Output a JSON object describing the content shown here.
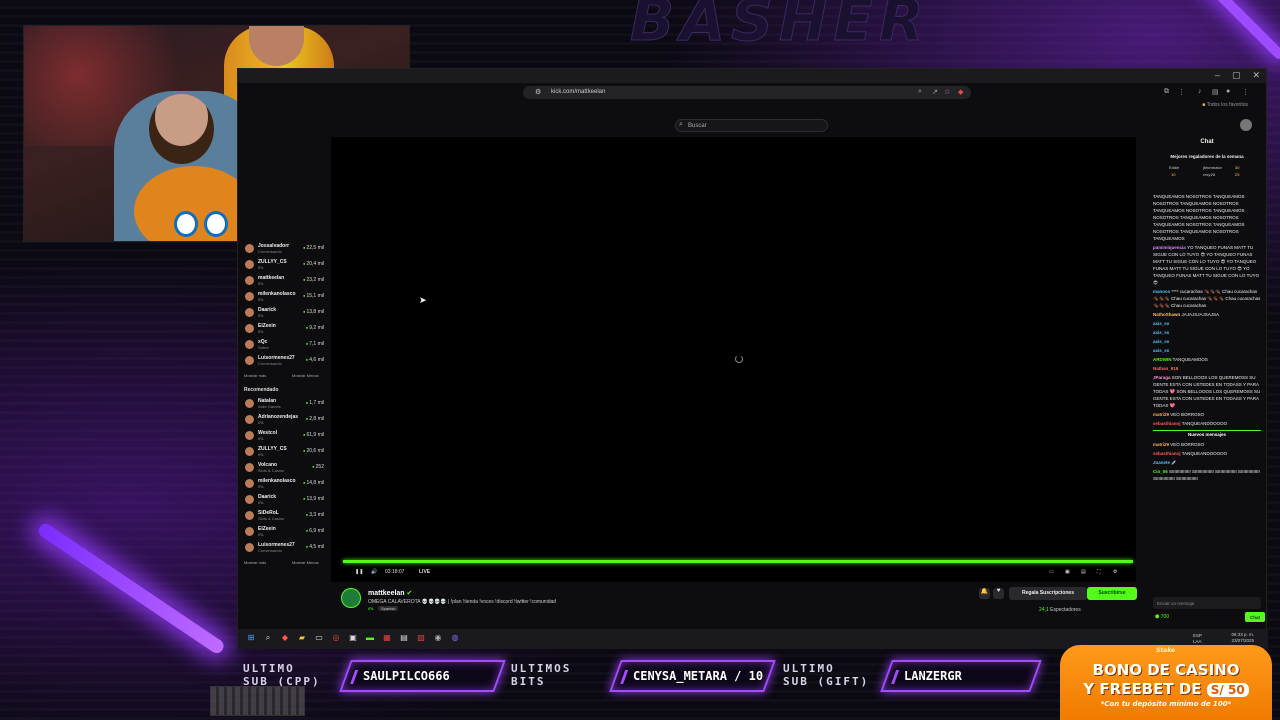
{
  "overlay": {
    "brand_text": "BASHER",
    "labels": [
      "ULTIMO\nSUB (CPP)",
      "ULTIMOS\nBITS",
      "ULTIMO\nSUB (GIFT)"
    ],
    "last_sub_cpp": "SAULPILCO666",
    "last_bits": "CENYSA_METARA / 10",
    "last_sub_gift": "LANZERGR",
    "promo": {
      "logo": "Stake",
      "line1": "BONO DE CASINO",
      "line2": "Y FREEBET DE",
      "amount": "S/ 50",
      "line3": "*Con tu depósito mínimo de 100*"
    }
  },
  "browser": {
    "url": "kick.com/mattkeelan",
    "favorites": "Todos los favoritos",
    "search_placeholder": "Buscar",
    "window_controls": [
      "–",
      "▢",
      "✕"
    ]
  },
  "sidebar": {
    "following": [
      {
        "name": "Jossalvadorr",
        "category": "Conversando",
        "viewers": "22,5 mil"
      },
      {
        "name": "ZULLYY_CS",
        "category": "IRL",
        "viewers": "20,4 mil"
      },
      {
        "name": "mattkeelan",
        "category": "IRL",
        "viewers": "23,2 mil"
      },
      {
        "name": "milenkanolasco",
        "category": "IRL",
        "viewers": "15,1 mil"
      },
      {
        "name": "Daarick",
        "category": "IRL",
        "viewers": "13,8 mil"
      },
      {
        "name": "ElZeein",
        "category": "IRL",
        "viewers": "9,2 mil"
      },
      {
        "name": "xQc",
        "category": "Sobre",
        "viewers": "7,1 mil"
      },
      {
        "name": "Luisormenes27",
        "category": "Conversando",
        "viewers": "4,6 mil"
      }
    ],
    "show_more": "Mostrar más",
    "show_less": "Mostrar Menos",
    "recommended_title": "Recomendado",
    "recommended": [
      {
        "name": "Natalan",
        "category": "Indie Games",
        "viewers": "1,7 mil"
      },
      {
        "name": "Adrianozendejas",
        "category": "IRL",
        "viewers": "2,8 mil"
      },
      {
        "name": "Westcol",
        "category": "IRL",
        "viewers": "61,9 mil"
      },
      {
        "name": "ZULLYY_CS",
        "category": "IRL",
        "viewers": "20,6 mil"
      },
      {
        "name": "Volcano",
        "category": "Slots & Casino",
        "viewers": "252"
      },
      {
        "name": "milenkanolasco",
        "category": "IRL",
        "viewers": "14,8 mil"
      },
      {
        "name": "Daarick",
        "category": "IRL",
        "viewers": "13,9 mil"
      },
      {
        "name": "SiDeRoL",
        "category": "Slots & Casino",
        "viewers": "3,3 mil"
      },
      {
        "name": "ElZeein",
        "category": "IRL",
        "viewers": "6,9 mil"
      },
      {
        "name": "Luisormenes27",
        "category": "Conversando",
        "viewers": "4,5 mil"
      }
    ]
  },
  "player": {
    "time": "03:18:07",
    "live": "LIVE",
    "progress": 1.0
  },
  "stream": {
    "streamer": "mattkeelan",
    "title": "OMEGA CALAVEROTA 💀💀💀💀 | !plan !tienda !voces !discord !twitter !comunidad",
    "category": "IRL",
    "language": "Spanish",
    "gift_label": "Regala Suscripciones",
    "subscribe_label": "Suscribirse",
    "viewers": "24,1",
    "viewers_label": "Espectadores"
  },
  "chat": {
    "title": "Chat",
    "top_gifters_title": "Mejores regaladores de la semana",
    "gifters": [
      {
        "name": "Eddie",
        "count": "10"
      },
      {
        "name": "jbhermalor",
        "count": "30"
      },
      {
        "name": "rexy28",
        "count": "25"
      }
    ],
    "pinned": "Enviado por",
    "messages": [
      {
        "user": "",
        "text": "TANQUEAMOS NOSOTROS TANQUEAMOS NOSOTROS TANQUEAMOS NOSOTROS TANQUEAMOS NOSOTROS TANQUEAMOS NOSOTROS TANQUEAMOS NOSOTROS TANQUEAMOS NOSOTROS TANQUEAMOS NOSOTROS TANQUEAMOS NOSOTROS TANQUEAMOS",
        "color": "#e8e8ee"
      },
      {
        "user": "pamimiquencia",
        "text": "YO TANQUEO FUNAS MATT TU SIGUE CON LO TUYO 😎 YO TANQUEO FUNAS MATT TU SIGUE CON LO TUYO 😎 YO TANQUEO FUNAS MATT TU SIGUE CON LO TUYO 😎 YO TANQUEO FUNAS MATT TU SIGUE CON LO TUYO 😎",
        "color": "#d98cff"
      },
      {
        "user": "manoco",
        "text": "**** cucarachas 🪳🪳🪳 Chau cucarachas 🪳🪳🪳 Chau cucarachas 🪳🪳🪳 Chau cucarachas 🪳🪳🪳 Chau cucarachas",
        "color": "#53c6fc"
      },
      {
        "user": "NathoShawn",
        "text": "JAJAJSJAJSAJSA",
        "color": "#ffc14a"
      },
      {
        "user": "axis_ss",
        "text": "",
        "color": "#53c6fc"
      },
      {
        "user": "axis_ss",
        "text": "",
        "color": "#53c6fc"
      },
      {
        "user": "axis_ss",
        "text": "",
        "color": "#53c6fc"
      },
      {
        "user": "axis_ss",
        "text": "",
        "color": "#53c6fc"
      },
      {
        "user": "ARDWIN",
        "text": "TANQUEAMOOS",
        "color": "#53fc18"
      },
      {
        "user": "Nathan_616",
        "text": "",
        "color": "#ff6b6b"
      },
      {
        "user": "JParaga",
        "text": "SON BELLOOOS LOS QUEREMOSS SU GENTE ESTA CON USTEDES EN TODASS Y PARA TODAS 💖 SON BELLOOOS LOS QUEREMOSS SU GENTE ESTA CON USTEDES EN TODASS Y PARA TODAS 💖",
        "color": "#ff8cd9"
      },
      {
        "user": "matri29",
        "text": "VEO BORROSO",
        "color": "#ffb24a"
      },
      {
        "user": "sebasthianoj",
        "text": "TANQUEANDOOOOO",
        "color": "#ff5b5b"
      }
    ],
    "new_messages": "Nuevos mensajes",
    "messages_after": [
      {
        "user": "matri29",
        "text": "VEO BORROSO",
        "color": "#ffb24a"
      },
      {
        "user": "sebasthianoj",
        "text": "TANQUEANDOOOOO",
        "color": "#ff5b5b"
      },
      {
        "user": "Juanete",
        "text": "💉",
        "color": "#53c6fc"
      },
      {
        "user": "Cio_06",
        "text": "SIIIIIIIIIIIIIII SIIIIIIIIIIIIIII SIIIIIIIIIIIIIII SIIIIIIIIIIIIIII SIIIIIIIIIIIIIII SIIIIIIIIIIIIIII",
        "color": "#53fc18"
      }
    ],
    "input_placeholder": "Enviar un mensaje",
    "points": "700",
    "send_label": "Chat"
  },
  "taskbar": {
    "lang": "ESP\nLAA",
    "time": "06:33 p. m.",
    "date": "23/07/2025"
  }
}
